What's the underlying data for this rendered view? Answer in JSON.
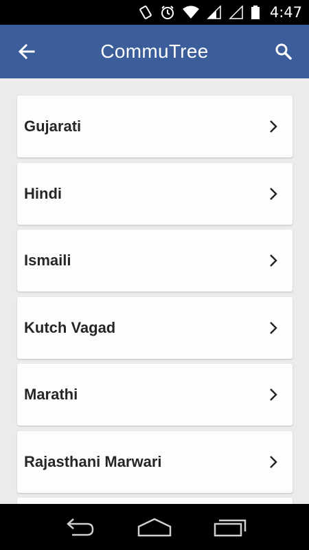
{
  "status_bar": {
    "time": "4:47",
    "icons": [
      "vibrate-icon",
      "alarm-icon",
      "wifi-icon",
      "signal-icon",
      "no-signal-icon",
      "battery-icon"
    ]
  },
  "app_bar": {
    "title": "CommuTree",
    "background": "#3b5e9b",
    "back_icon": "arrow-left-icon",
    "search_icon": "search-icon"
  },
  "list": {
    "items": [
      {
        "label": "Gujarati"
      },
      {
        "label": "Hindi"
      },
      {
        "label": "Ismaili"
      },
      {
        "label": "Kutch Vagad"
      },
      {
        "label": "Marathi"
      },
      {
        "label": "Rajasthani Marwari"
      },
      {
        "label": ""
      }
    ]
  },
  "nav_bar": {
    "icons": [
      "back-nav-icon",
      "home-nav-icon",
      "recents-nav-icon"
    ]
  }
}
